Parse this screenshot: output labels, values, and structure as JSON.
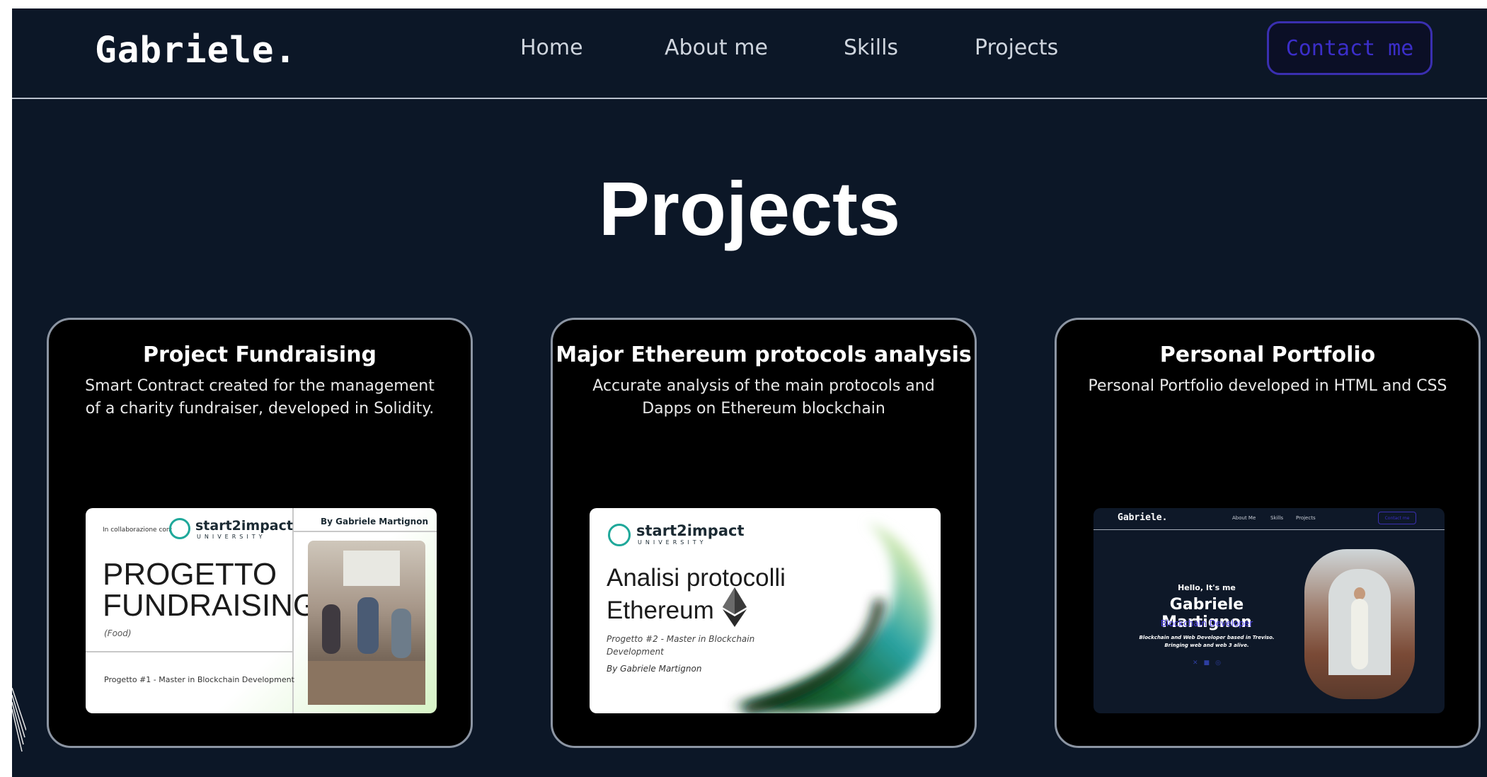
{
  "nav": {
    "logo": "Gabriele.",
    "links": [
      "Home",
      "About me",
      "Skills",
      "Projects"
    ],
    "contact": "Contact me"
  },
  "section_title": "Projects",
  "projects": [
    {
      "title": "Project Fundraising",
      "description": "Smart Contract created for the management of a charity fundraiser, developed in Solidity.",
      "image": {
        "collab": "In collaborazione con:",
        "brand": "start2impact",
        "brand_sub": "UNIVERSITY",
        "author": "By Gabriele Martignon",
        "heading_line1": "PROGETTO",
        "heading_line2": "FUNDRAISING",
        "subtitle": "(Food)",
        "footer": "Progetto #1 - Master in Blockchain Development"
      }
    },
    {
      "title": "Major Ethereum protocols analysis",
      "description": "Accurate analysis of the main protocols and Dapps on Ethereum blockchain",
      "image": {
        "brand": "start2impact",
        "brand_sub": "UNIVERSITY",
        "heading_line1": "Analisi protocolli",
        "heading_line2": "Ethereum",
        "subtitle": "Progetto #2 - Master in Blockchain Development",
        "author": "By Gabriele Martignon"
      }
    },
    {
      "title": "Personal Portfolio",
      "description": "Personal Portfolio developed in HTML and CSS",
      "image": {
        "logo": "Gabriele.",
        "links": [
          "About Me",
          "Skills",
          "Projects"
        ],
        "contact": "Contact me",
        "greeting": "Hello, It's me",
        "name": "Gabriele Martignon",
        "role": "Blockchain Developer",
        "bio_line1": "Blockchain and Web Developer based in Treviso.",
        "bio_line2": "Bringing web and web 3 alive."
      }
    }
  ],
  "colors": {
    "background": "#0c1727",
    "card": "#000000",
    "accent": "#3b2ec9",
    "text": "#ffffff"
  }
}
